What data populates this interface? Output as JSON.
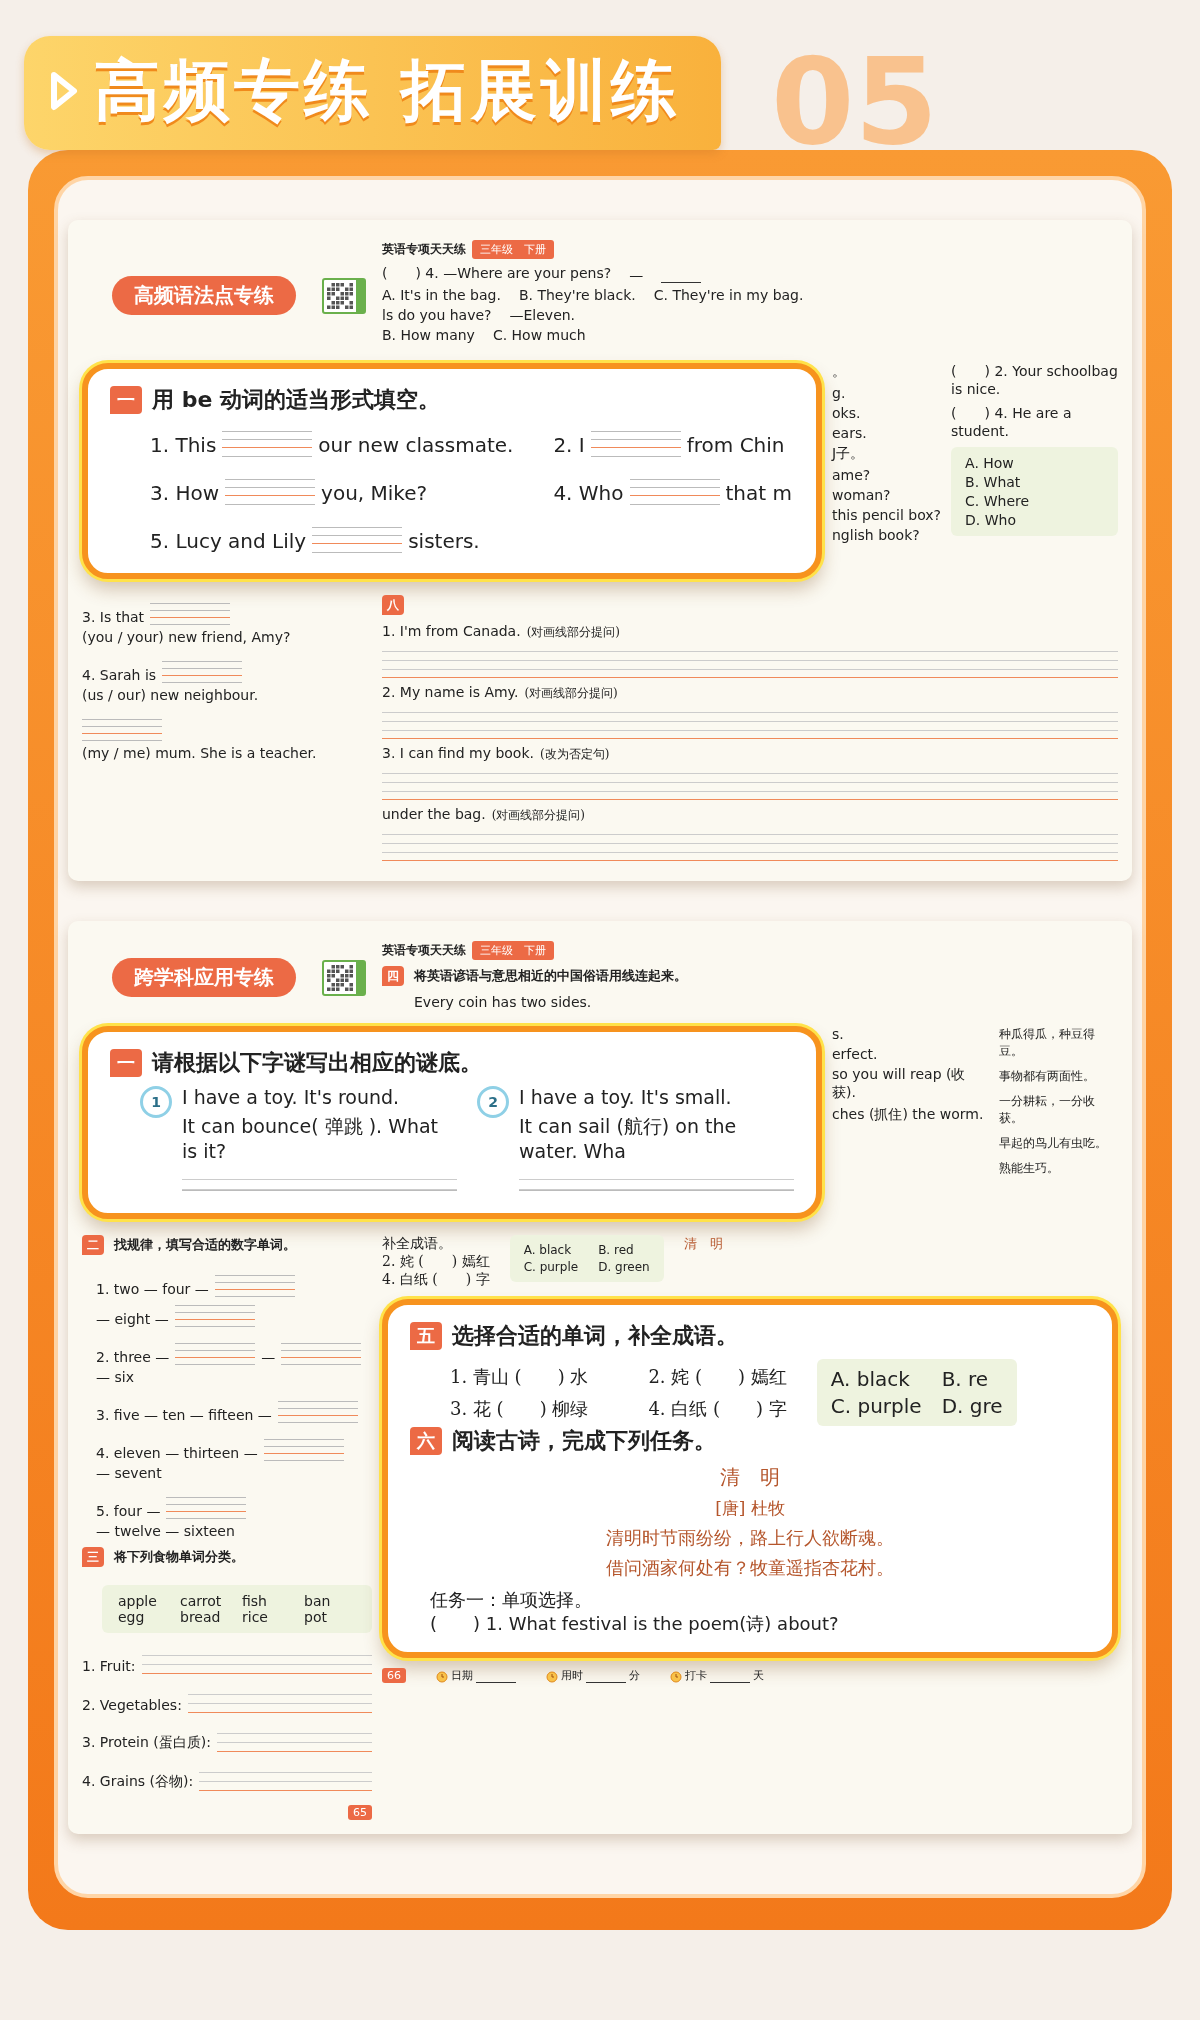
{
  "banner": {
    "title": "高频专练 拓展训练",
    "number": "05"
  },
  "spread_1": {
    "left_page": {
      "pill": "高频语法点专练",
      "items": [
        {
          "parts": [
            {
              "kind": "text",
              "text": "3. Is that"
            },
            {
              "kind": "blank"
            },
            {
              "kind": "text",
              "text": "(you / your) new friend, Amy?"
            }
          ]
        },
        {
          "parts": [
            {
              "kind": "text",
              "text": "4. Sarah is"
            },
            {
              "kind": "blank"
            },
            {
              "kind": "text",
              "text": "(us / our) new neighbour."
            }
          ]
        },
        {
          "parts": [
            {
              "kind": "blank"
            },
            {
              "kind": "text",
              "text": "(my / me) mum. She is a teacher."
            }
          ]
        }
      ]
    },
    "right_page": {
      "header": {
        "series": "英语专项天天练",
        "grade": "三年级",
        "volume": "下册"
      },
      "top_lines": [
        {
          "parts": [
            {
              "kind": "text",
              "text": "(　　) 4. —Where are your pens?"
            },
            {
              "kind": "text",
              "text": "—"
            },
            {
              "kind": "short"
            }
          ]
        },
        {
          "parts": [
            {
              "kind": "text",
              "text": "A. It's in the bag."
            },
            {
              "kind": "text",
              "text": "B. They're black."
            },
            {
              "kind": "text",
              "text": "C. They're in my bag."
            }
          ]
        },
        {
          "parts": [
            {
              "kind": "text",
              "text": "ls do you have?"
            },
            {
              "kind": "text",
              "text": "—Eleven."
            }
          ]
        },
        {
          "parts": [
            {
              "kind": "text",
              "text": "B. How many"
            },
            {
              "kind": "text",
              "text": "C. How much"
            }
          ]
        }
      ],
      "fragments": [
        "。",
        "g.",
        "oks.",
        "ears.",
        "J子。",
        "ame?",
        "woman?",
        "this pencil box?",
        "nglish book?"
      ],
      "judge_items": [
        "(　　) 2. Your schoolbag is nice.",
        "(　　) 4. He are a student."
      ],
      "options": [
        "A. How",
        "B. What",
        "C. Where",
        "D. Who"
      ],
      "section": {
        "marker": "八",
        "items": [
          {
            "sentence": "1. I'm from Canada.",
            "note": "(对画线部分提问)"
          },
          {
            "sentence": "2. My name is Amy.",
            "note": "(对画线部分提问)"
          },
          {
            "sentence": "3. I can find my book.",
            "note": "(改为否定句)"
          },
          {
            "sentence": "under the bag.",
            "note": "(对画线部分提问)"
          }
        ]
      }
    },
    "callout": {
      "marker": "一",
      "title": "用 be 动词的适当形式填空。",
      "items": [
        {
          "parts": [
            {
              "kind": "text",
              "text": "1. This"
            },
            {
              "kind": "blank"
            },
            {
              "kind": "text",
              "text": "our new classmate."
            }
          ]
        },
        {
          "parts": [
            {
              "kind": "text",
              "text": "2. I"
            },
            {
              "kind": "blank"
            },
            {
              "kind": "text",
              "text": "from Chin"
            }
          ]
        },
        {
          "parts": [
            {
              "kind": "text",
              "text": "3. How"
            },
            {
              "kind": "blank"
            },
            {
              "kind": "text",
              "text": "you, Mike?"
            }
          ]
        },
        {
          "parts": [
            {
              "kind": "text",
              "text": "4. Who"
            },
            {
              "kind": "blank"
            },
            {
              "kind": "text",
              "text": "that m"
            }
          ]
        },
        {
          "parts": [
            {
              "kind": "text",
              "text": "5. Lucy and Lily"
            },
            {
              "kind": "blank"
            },
            {
              "kind": "text",
              "text": "sisters."
            }
          ]
        }
      ]
    }
  },
  "spread_2": {
    "left_page": {
      "pill": "跨学科应用专练",
      "sections": [
        {
          "marker": "二",
          "title": "找规律，填写合适的数字单词。",
          "kind": "sequence",
          "items": [
            {
              "parts": [
                {
                  "kind": "text",
                  "text": "1. two — four —"
                },
                {
                  "kind": "blank"
                },
                {
                  "kind": "text",
                  "text": "— eight —"
                },
                {
                  "kind": "blank"
                }
              ]
            },
            {
              "parts": [
                {
                  "kind": "text",
                  "text": "2. three —"
                },
                {
                  "kind": "blank"
                },
                {
                  "kind": "text",
                  "text": "—"
                },
                {
                  "kind": "blank"
                },
                {
                  "kind": "text",
                  "text": "— six"
                }
              ]
            },
            {
              "parts": [
                {
                  "kind": "text",
                  "text": "3. five — ten — fifteen —"
                },
                {
                  "kind": "blank"
                }
              ]
            },
            {
              "parts": [
                {
                  "kind": "text",
                  "text": "4. eleven — thirteen —"
                },
                {
                  "kind": "blank"
                },
                {
                  "kind": "text",
                  "text": "— sevent"
                }
              ]
            },
            {
              "parts": [
                {
                  "kind": "text",
                  "text": "5. four —"
                },
                {
                  "kind": "blank"
                },
                {
                  "kind": "text",
                  "text": "— twelve — sixteen"
                }
              ]
            }
          ]
        },
        {
          "marker": "三",
          "title": "将下列食物单词分类。",
          "kind": "sort",
          "words": [
            [
              "apple",
              "egg"
            ],
            [
              "carrot",
              "bread"
            ],
            [
              "fish",
              "rice"
            ],
            [
              "ban",
              "pot"
            ]
          ],
          "categories": [
            "1. Fruit:",
            "2. Vegetables:",
            "3. Protein (蛋白质):",
            "4. Grains (谷物):"
          ]
        }
      ],
      "page_number": "65"
    },
    "right_page": {
      "header": {
        "series": "英语专项天天练",
        "grade": "三年级",
        "volume": "下册"
      },
      "section": {
        "marker": "四",
        "title": "将英语谚语与意思相近的中国俗语用线连起来。",
        "first": "Every coin has two sides."
      },
      "fragments": [
        "s.",
        "erfect.",
        "so you will reap (收获).",
        "ches (抓住) the worm."
      ],
      "proverbs": [
        "种瓜得瓜，种豆得豆。",
        "事物都有两面性。",
        "一分耕耘，一分收获。",
        "早起的鸟儿有虫吃。",
        "熟能生巧。"
      ],
      "strip": {
        "title": "补全成语。",
        "items": [
          "2. 姹 (　　) 嫣红",
          "4. 白纸 (　　) 字"
        ],
        "options": [
          "A. black",
          "B. red",
          "C. purple",
          "D. green"
        ],
        "poem_title": "清　明"
      },
      "footer": {
        "page_number": "66",
        "fields": [
          {
            "label": "日期"
          },
          {
            "label": "用时",
            "unit": "分"
          },
          {
            "label": "打卡",
            "unit": "天"
          }
        ]
      }
    },
    "callout_1": {
      "marker": "一",
      "title": "请根据以下字谜写出相应的谜底。",
      "riddles": [
        {
          "number": "1",
          "lines": [
            "I have a toy. It's round.",
            "It can bounce( 弹跳 ). What is it?"
          ]
        },
        {
          "number": "2",
          "lines": [
            "I have a toy. It's small.",
            "It can sail (航行) on the water. Wha"
          ]
        }
      ]
    },
    "callout_2": {
      "sections": [
        {
          "marker": "五",
          "title": "选择合适的单词，补全成语。",
          "items": [
            "1. 青山 (　　) 水",
            "2. 姹 (　　) 嫣红",
            "3. 花 (　　) 柳绿",
            "4. 白纸 (　　) 字"
          ],
          "options": [
            "A. black",
            "B. re",
            "C. purple",
            "D. gre"
          ]
        },
        {
          "marker": "六",
          "title": "阅读古诗，完成下列任务。",
          "poem": {
            "title": "清　明",
            "author": "[唐] 杜牧",
            "lines": [
              "清明时节雨纷纷，路上行人欲断魂。",
              "借问酒家何处有？牧童遥指杏花村。"
            ]
          },
          "task": "任务一：单项选择。",
          "question": "(　　) 1. What festival is the poem(诗) about?"
        }
      ]
    }
  }
}
